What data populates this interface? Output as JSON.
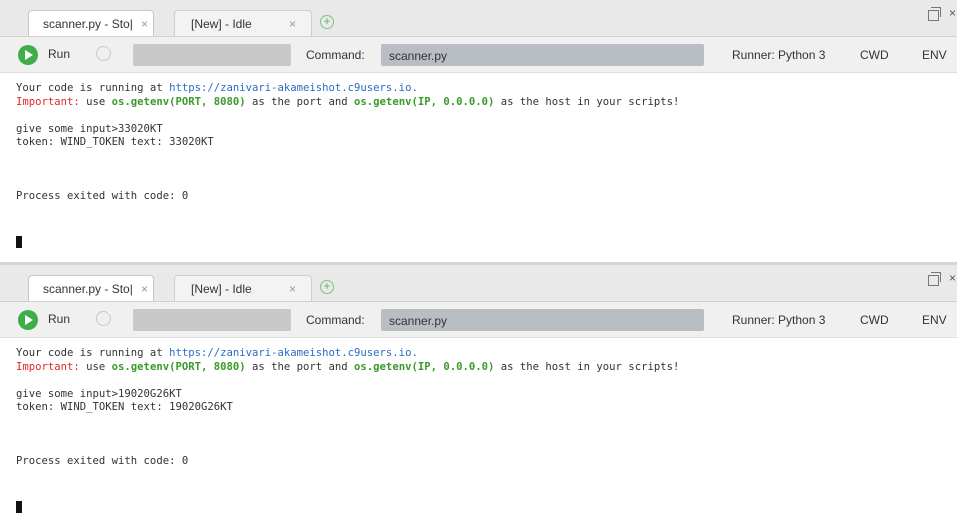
{
  "panels": [
    {
      "tabs": [
        {
          "label": "scanner.py - Stopped",
          "visible_label": "scanner.py - Sto|",
          "close": "×",
          "active": true
        },
        {
          "label": "[New] - Idle",
          "close": "×",
          "active": false
        }
      ],
      "add_tab_icon": "plus-circle",
      "toolbar": {
        "run_label": "Run",
        "command_label": "Command:",
        "command_value": "scanner.py",
        "runner": "Runner: Python 3",
        "cwd": "CWD",
        "env": "ENV"
      },
      "output": {
        "running_prefix": "Your code is running at ",
        "url": "https://zanivari-akameishot.c9users.io.",
        "important_label": "Important:",
        "important_use": " use ",
        "port_call": "os.getenv(PORT, 8080)",
        "important_mid": " as the port and ",
        "ip_call": "os.getenv(IP, 0.0.0.0)",
        "important_end": " as the host in your scripts!",
        "input_line": "give some input>33020KT",
        "token_line": "token: WIND_TOKEN text: 33020KT",
        "exit_line": "Process exited with code: 0"
      }
    },
    {
      "tabs": [
        {
          "label": "scanner.py - Stopped",
          "visible_label": "scanner.py - Sto|",
          "close": "×",
          "active": true
        },
        {
          "label": "[New] - Idle",
          "close": "×",
          "active": false
        }
      ],
      "add_tab_icon": "plus-circle",
      "toolbar": {
        "run_label": "Run",
        "command_label": "Command:",
        "command_value": "scanner.py",
        "runner": "Runner: Python 3",
        "cwd": "CWD",
        "env": "ENV"
      },
      "output": {
        "running_prefix": "Your code is running at ",
        "url": "https://zanivari-akameishot.c9users.io.",
        "important_label": "Important:",
        "important_use": " use ",
        "port_call": "os.getenv(PORT, 8080)",
        "important_mid": " as the port and ",
        "ip_call": "os.getenv(IP, 0.0.0.0)",
        "important_end": " as the host in your scripts!",
        "input_line": "give some input>19020G26KT",
        "token_line": "token: WIND_TOKEN text: 19020G26KT",
        "exit_line": "Process exited with code: 0"
      }
    }
  ],
  "colors": {
    "run_green": "#3fae49",
    "url_blue": "#2a6cc4",
    "important_red": "#e0282c",
    "code_green": "#3a9a2a"
  }
}
